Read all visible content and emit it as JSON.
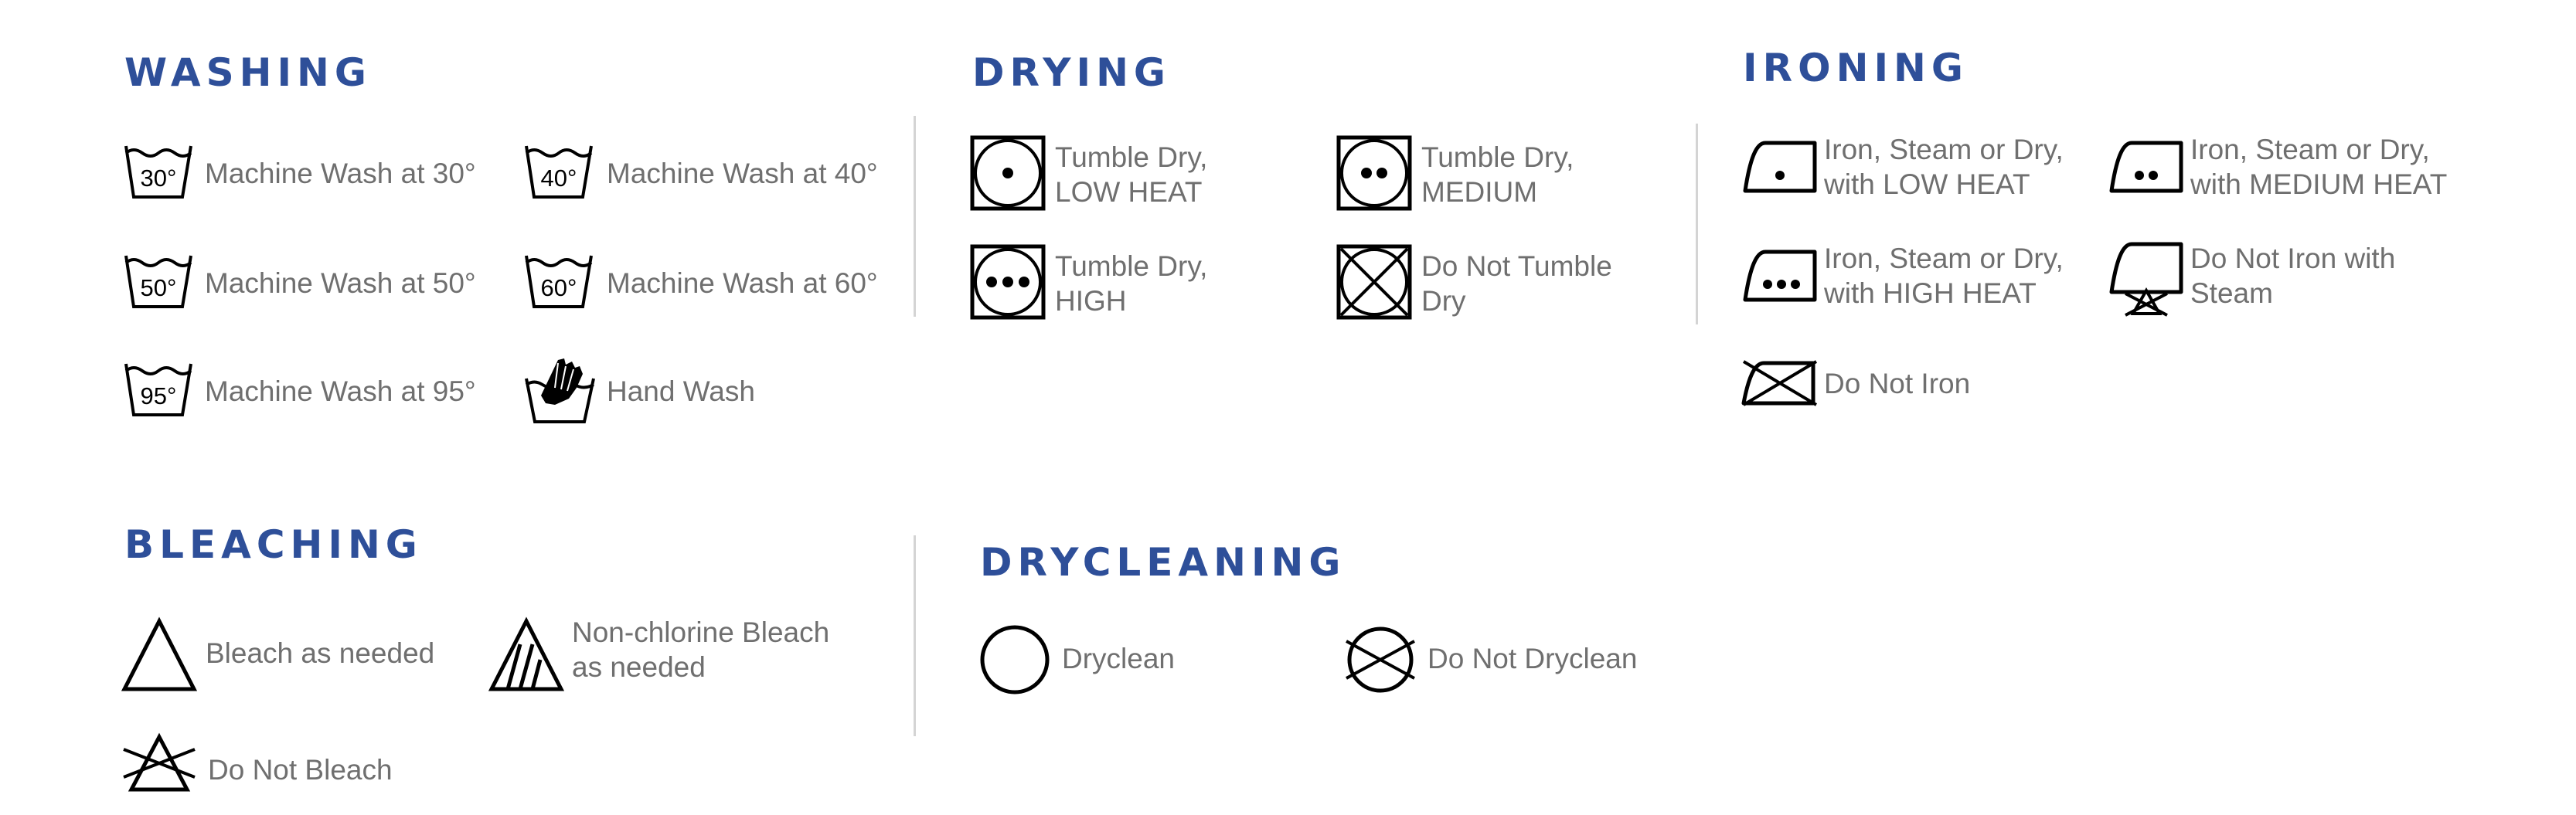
{
  "colors": {
    "heading": "#2e4f99",
    "label": "#6f6f6f",
    "icon": "#000000",
    "divider": "#d4d4d4"
  },
  "sections": {
    "washing": {
      "title": "WASHING",
      "items": [
        {
          "icon": "wash-tub-icon",
          "temp": "30°",
          "label": "Machine Wash at 30°"
        },
        {
          "icon": "wash-tub-icon",
          "temp": "40°",
          "label": "Machine Wash at 40°"
        },
        {
          "icon": "wash-tub-icon",
          "temp": "50°",
          "label": "Machine Wash at 50°"
        },
        {
          "icon": "wash-tub-icon",
          "temp": "60°",
          "label": "Machine Wash at 60°"
        },
        {
          "icon": "wash-tub-icon",
          "temp": "95°",
          "label": "Machine Wash at 95°"
        },
        {
          "icon": "hand-wash-icon",
          "label": "Hand Wash"
        }
      ]
    },
    "drying": {
      "title": "DRYING",
      "items": [
        {
          "icon": "tumble-dry-low-icon",
          "line1": "Tumble Dry,",
          "line2": "LOW HEAT"
        },
        {
          "icon": "tumble-dry-medium-icon",
          "line1": "Tumble Dry,",
          "line2": "MEDIUM"
        },
        {
          "icon": "tumble-dry-high-icon",
          "line1": "Tumble Dry,",
          "line2": "HIGH"
        },
        {
          "icon": "do-not-tumble-dry-icon",
          "line1": "Do Not Tumble",
          "line2": "Dry"
        }
      ]
    },
    "ironing": {
      "title": "IRONING",
      "items": [
        {
          "icon": "iron-low-heat-icon",
          "line1": "Iron, Steam or Dry,",
          "line2": "with LOW HEAT"
        },
        {
          "icon": "iron-medium-heat-icon",
          "line1": "Iron, Steam or Dry,",
          "line2": "with MEDIUM HEAT"
        },
        {
          "icon": "iron-high-heat-icon",
          "line1": "Iron, Steam or Dry,",
          "line2": "with HIGH HEAT"
        },
        {
          "icon": "do-not-iron-steam-icon",
          "line1": "Do Not Iron with",
          "line2": "Steam"
        },
        {
          "icon": "do-not-iron-icon",
          "label": "Do Not Iron"
        }
      ]
    },
    "bleaching": {
      "title": "BLEACHING",
      "items": [
        {
          "icon": "bleach-icon",
          "label": "Bleach as needed"
        },
        {
          "icon": "non-chlorine-bleach-icon",
          "line1": "Non-chlorine Bleach",
          "line2": "as needed"
        },
        {
          "icon": "do-not-bleach-icon",
          "label": "Do Not Bleach"
        }
      ]
    },
    "drycleaning": {
      "title": "DRYCLEANING",
      "items": [
        {
          "icon": "dryclean-icon",
          "label": "Dryclean"
        },
        {
          "icon": "do-not-dryclean-icon",
          "label": "Do Not Dryclean"
        }
      ]
    }
  }
}
